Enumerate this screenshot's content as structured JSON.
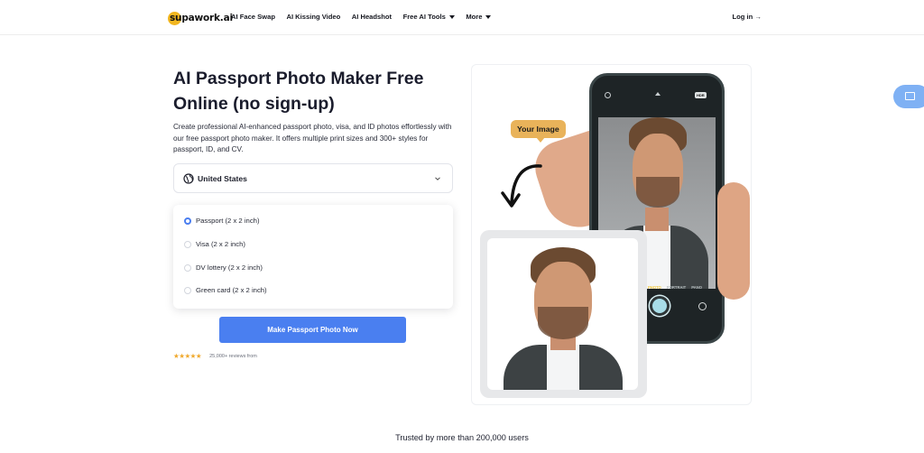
{
  "header": {
    "logo_text": "supawork.ai",
    "nav": [
      {
        "label": "AI Face Swap"
      },
      {
        "label": "AI Kissing Video"
      },
      {
        "label": "AI Headshot"
      },
      {
        "label": "Free AI Tools"
      },
      {
        "label": "More"
      }
    ],
    "login_label": "Log in →"
  },
  "main": {
    "title": "AI Passport Photo Maker Free Online (no sign-up)",
    "description": "Create professional AI-enhanced passport photo, visa, and ID photos effortlessly with our free passport photo maker. It offers multiple print sizes and 300+ styles for passport, ID, and CV.",
    "country": {
      "selected": "United States",
      "icon": "globe-icon"
    },
    "photo_types": [
      {
        "label": "Passport (2 x 2 inch)",
        "selected": true
      },
      {
        "label": "Visa (2 x 2 inch)",
        "selected": false
      },
      {
        "label": "DV lottery (2 x 2 inch)",
        "selected": false
      },
      {
        "label": "Green card (2 x 2 inch)",
        "selected": false
      }
    ],
    "cta_label": "Make Passport Photo Now",
    "rating": {
      "stars": "★★★★★",
      "reviews": "25,000+ reviews from"
    }
  },
  "hero": {
    "tag": "Your Image",
    "camera_modes": [
      "PHOTO",
      "PORTRAIT",
      "PANO"
    ],
    "hdr": "HDR"
  },
  "footer": {
    "trusted": "Trusted by more than 200,000 users"
  },
  "colors": {
    "accent": "#4a7ff0",
    "tag": "#e9b35a",
    "stars": "#f0a92e"
  }
}
